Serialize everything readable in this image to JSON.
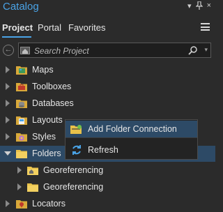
{
  "pane": {
    "title": "Catalog",
    "controls": {
      "dropdown": "▾",
      "pin": "ꟷ",
      "close": "×"
    }
  },
  "tabs": [
    {
      "label": "Project",
      "active": true
    },
    {
      "label": "Portal",
      "active": false
    },
    {
      "label": "Favorites",
      "active": false
    }
  ],
  "search": {
    "placeholder": "Search Project"
  },
  "tree": [
    {
      "label": "Maps",
      "icon": "maps-folder-icon"
    },
    {
      "label": "Toolboxes",
      "icon": "toolbox-folder-icon"
    },
    {
      "label": "Databases",
      "icon": "database-folder-icon"
    },
    {
      "label": "Layouts",
      "icon": "layouts-folder-icon"
    },
    {
      "label": "Styles",
      "icon": "styles-folder-icon"
    },
    {
      "label": "Folders",
      "icon": "folders-icon",
      "selected": true,
      "expanded": true
    },
    {
      "label": "Georeferencing",
      "icon": "home-folder-icon"
    },
    {
      "label": "Georeferencing",
      "icon": "folder-icon"
    },
    {
      "label": "Locators",
      "icon": "locators-folder-icon"
    }
  ],
  "context_menu": {
    "items": [
      {
        "label": "Add Folder Connection",
        "icon": "add-folder-connection-icon"
      },
      {
        "label": "Refresh",
        "icon": "refresh-icon"
      }
    ]
  },
  "colors": {
    "accent": "#4aa3e6",
    "selection": "#2d4a66",
    "background": "#2b2b2b",
    "folder": "#e8c14a"
  }
}
